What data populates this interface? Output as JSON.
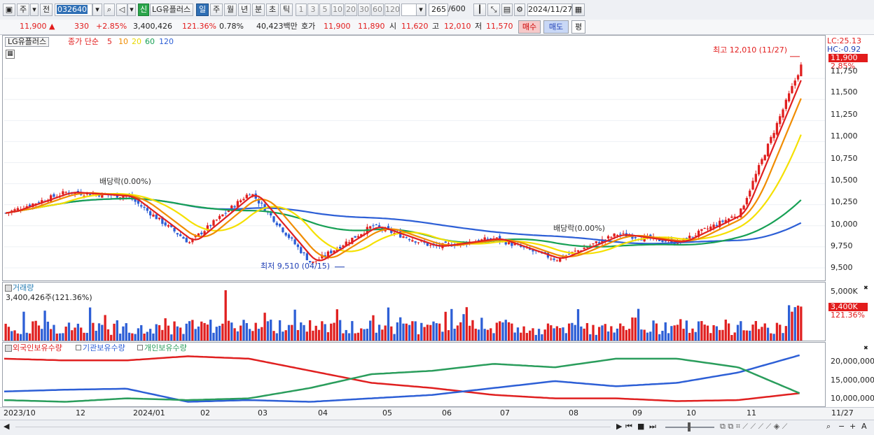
{
  "toolbar": {
    "type_label": "주",
    "prev_label": "전",
    "code_value": "032640",
    "stock_new_badge": "신",
    "stock_name": "LG유플러스",
    "periods": [
      "일",
      "주",
      "월",
      "년",
      "분",
      "초",
      "틱"
    ],
    "active_period": "일",
    "minute_units": [
      "1",
      "3",
      "5",
      "10",
      "20",
      "30",
      "60",
      "120"
    ],
    "count_value": "265",
    "count_total": "/600",
    "date_value": "2024/11/27"
  },
  "quote": {
    "price": "11,900 ▲",
    "change": "330",
    "change_pct": "+2.85%",
    "volume": "3,400,426",
    "volume_ratio": "121.36%",
    "turnover": "0.78%",
    "amount": "40,423백만",
    "ask_label": "호가",
    "ask": "11,900",
    "bid": "11,890",
    "open_label": "시",
    "open": "11,620",
    "high_label": "고",
    "high": "12,010",
    "low_label": "저",
    "low": "11,570",
    "buy_label": "매수",
    "sell_label": "매도",
    "eval_label": "평"
  },
  "price_panel": {
    "stock_tag": "LG유플러스",
    "ma_title": "종가 단순",
    "ma_periods": [
      "5",
      "10",
      "20",
      "60",
      "120"
    ],
    "ma_colors": [
      "#e02020",
      "#f08c00",
      "#f5e000",
      "#17a055",
      "#2d5fd6"
    ],
    "high_annotation": "최고 12,010 (11/27)",
    "low_annotation": "최저 9,510 (04/15)",
    "dividend_label": "배당락(0.00%)",
    "lc_label": "LC:25.13",
    "hc_label": "HC:-0.92",
    "current_price_tag": "11,900",
    "current_pct_tag": "2.85%",
    "y_ticks": [
      "11,750",
      "11,500",
      "11,250",
      "11,000",
      "10,750",
      "10,500",
      "10,250",
      "10,000",
      "9,750",
      "9,500"
    ]
  },
  "volume_panel": {
    "title": "거래량",
    "value_label": "3,400,426주(121.36%)",
    "y_ticks": [
      "5,000K"
    ],
    "current_tag": "3,400K",
    "current_pct": "121.36%"
  },
  "flow_panel": {
    "legend": [
      "외국인보유수량",
      "기관보유수량",
      "개인보유수량"
    ],
    "legend_colors": [
      "#e02020",
      "#2d5fd6",
      "#2a9d5c"
    ],
    "y_ticks": [
      "20,000,000",
      "15,000,000",
      "10,000,000"
    ]
  },
  "x_axis": {
    "labels": [
      "2023/10",
      "12",
      "2024/01",
      "02",
      "03",
      "04",
      "05",
      "06",
      "07",
      "08",
      "09",
      "10",
      "11"
    ],
    "end_label": "11/27"
  },
  "chart_data": {
    "type": "line",
    "title": "LG유플러스 일봉",
    "x": [
      "2023/10",
      "12",
      "2024/01",
      "02",
      "03",
      "04",
      "05",
      "06",
      "07",
      "08",
      "09",
      "10",
      "11",
      "11/27"
    ],
    "series": [
      {
        "name": "종가",
        "values": [
          10150,
          10400,
          10350,
          9800,
          10400,
          9550,
          10000,
          9750,
          9850,
          9600,
          9900,
          9800,
          10150,
          11900
        ]
      },
      {
        "name": "외국인보유수량",
        "values": [
          21500000,
          21000000,
          21000000,
          22200000,
          21500000,
          18000000,
          14500000,
          13000000,
          11000000,
          10000000,
          10000000,
          9200000,
          9500000,
          11500000
        ]
      },
      {
        "name": "기관보유수량",
        "values": [
          12000000,
          12500000,
          12800000,
          9000000,
          9500000,
          9000000,
          10000000,
          11000000,
          13000000,
          15000000,
          13500000,
          14500000,
          17500000,
          22500000
        ]
      },
      {
        "name": "개인보유수량",
        "values": [
          9500000,
          9000000,
          10000000,
          9500000,
          10000000,
          13000000,
          17000000,
          18000000,
          20000000,
          19000000,
          21500000,
          21500000,
          19000000,
          11500000
        ]
      }
    ],
    "ylim": [
      9400,
      12100
    ],
    "high": {
      "value": 12010,
      "date": "11/27"
    },
    "low": {
      "value": 9510,
      "date": "04/15"
    }
  }
}
